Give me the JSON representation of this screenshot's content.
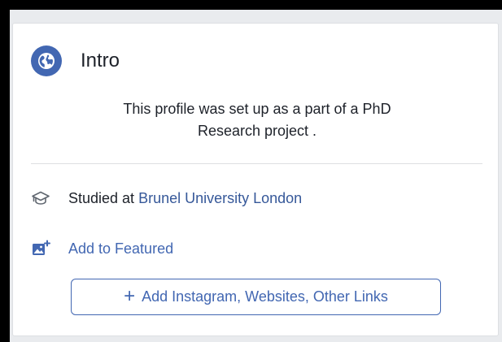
{
  "intro": {
    "title": "Intro",
    "bio_line1": "This profile was set up as a part of a PhD",
    "bio_line2": "Research project ."
  },
  "education": {
    "prefix": "Studied at",
    "school": "Brunel University London",
    "icon": "graduation-cap-icon"
  },
  "featured": {
    "label": "Add to Featured",
    "icon": "add-photo-icon"
  },
  "links_button": {
    "plus": "+",
    "label": "Add Instagram, Websites, Other Links"
  },
  "colors": {
    "brand_blue": "#4267b2",
    "link_blue": "#365899",
    "text": "#1d2129",
    "border": "#dddfe2"
  }
}
